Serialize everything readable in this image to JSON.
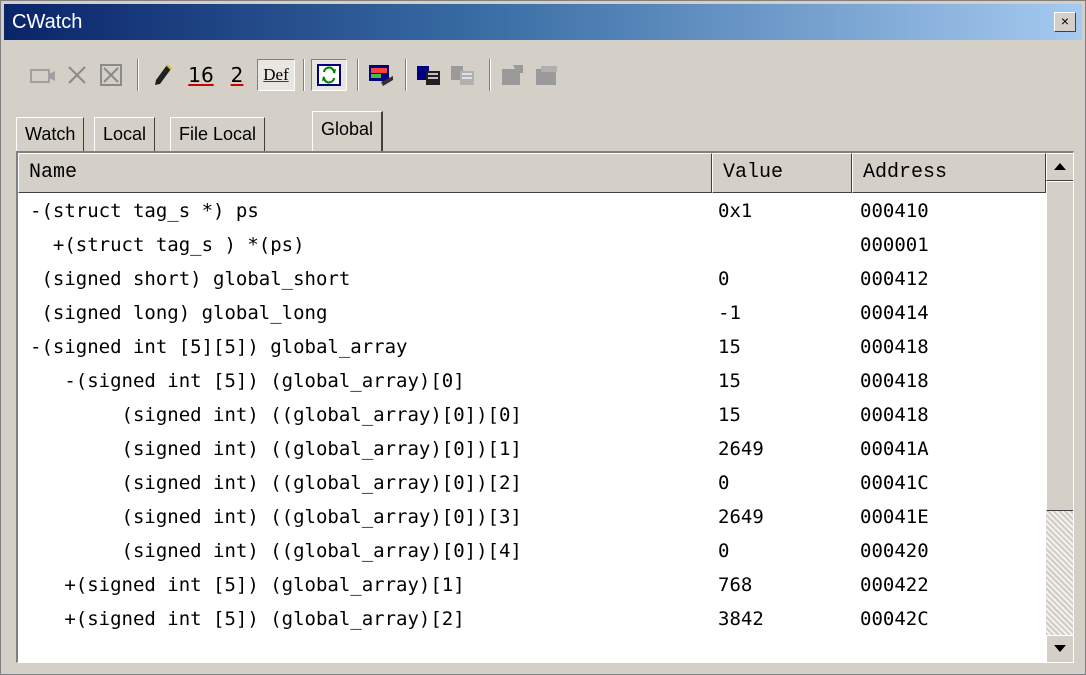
{
  "window": {
    "title": "CWatch",
    "close_symbol": "×"
  },
  "toolbar": {
    "buttons": [
      {
        "name": "add-watch-icon"
      },
      {
        "name": "delete-icon"
      },
      {
        "name": "delete-all-icon"
      },
      {
        "name": "edit-value-icon"
      },
      {
        "name": "radix-hex",
        "label": "16"
      },
      {
        "name": "radix-bin",
        "label": "2"
      },
      {
        "name": "radix-default",
        "label": "Def"
      },
      {
        "name": "refresh-icon"
      },
      {
        "name": "display-settings-icon"
      },
      {
        "name": "copy-icon"
      },
      {
        "name": "paste-icon"
      },
      {
        "name": "save-icon"
      },
      {
        "name": "load-icon"
      }
    ]
  },
  "tabs": [
    "Watch",
    "Local",
    "File Local",
    "Global"
  ],
  "active_tab": "Global",
  "columns": [
    "Name",
    "Value",
    "Address"
  ],
  "rows": [
    {
      "name": "-(struct tag_s *) ps",
      "value": "0x1",
      "address": "000410"
    },
    {
      "name": "  +(struct tag_s ) *(ps)",
      "value": "",
      "address": "000001"
    },
    {
      "name": " (signed short) global_short",
      "value": "0",
      "address": "000412"
    },
    {
      "name": " (signed long) global_long",
      "value": "-1",
      "address": "000414"
    },
    {
      "name": "-(signed int [5][5]) global_array",
      "value": "15",
      "address": "000418"
    },
    {
      "name": "   -(signed int [5]) (global_array)[0]",
      "value": "15",
      "address": "000418"
    },
    {
      "name": "        (signed int) ((global_array)[0])[0]",
      "value": "15",
      "address": "000418"
    },
    {
      "name": "        (signed int) ((global_array)[0])[1]",
      "value": "2649",
      "address": "00041A"
    },
    {
      "name": "        (signed int) ((global_array)[0])[2]",
      "value": "0",
      "address": "00041C"
    },
    {
      "name": "        (signed int) ((global_array)[0])[3]",
      "value": "2649",
      "address": "00041E"
    },
    {
      "name": "        (signed int) ((global_array)[0])[4]",
      "value": "0",
      "address": "000420"
    },
    {
      "name": "   +(signed int [5]) (global_array)[1]",
      "value": "768",
      "address": "000422"
    },
    {
      "name": "   +(signed int [5]) (global_array)[2]",
      "value": "3842",
      "address": "00042C"
    }
  ]
}
